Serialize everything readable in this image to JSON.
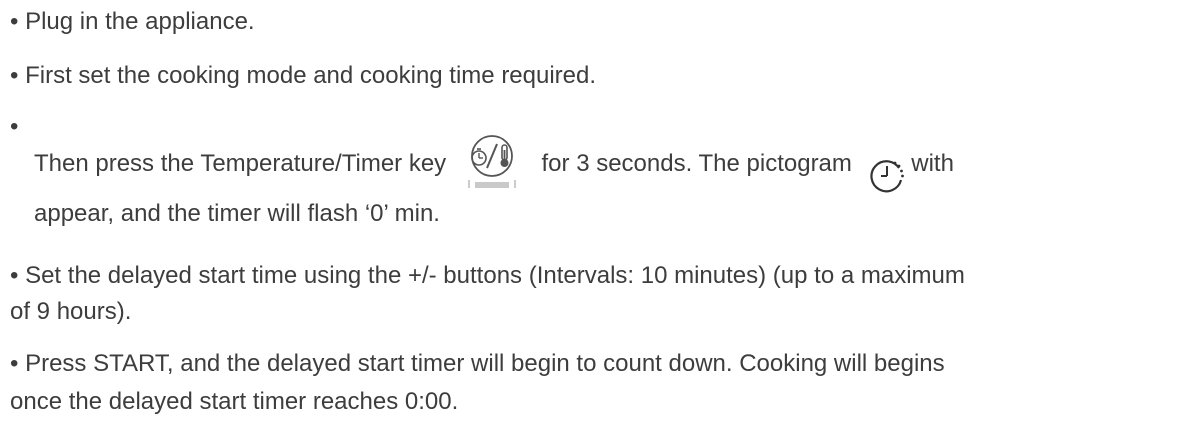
{
  "instructions": {
    "bullet": "•",
    "item1": "Plug in the appliance.",
    "item2": "First set the cooking mode and cooking time required.",
    "item3": {
      "text_before_key": "Then press the Temperature/Timer key",
      "text_after_key": "for 3 seconds. The pictogram",
      "text_after_pictogram": "with",
      "line2": "appear, and the timer will flash ‘0’ min.",
      "key_icon": "timer-temperature-key-icon",
      "pictogram_icon": "clock-icon"
    },
    "item4": {
      "line1": "Set the delayed start time using the +/- buttons (Intervals: 10 minutes) (up to a maximum",
      "line2": "of 9 hours)."
    },
    "item5": {
      "line1": "Press START, and the delayed start timer will begin to count down. Cooking will begins",
      "line2": "once the delayed start timer reaches 0:00."
    }
  }
}
